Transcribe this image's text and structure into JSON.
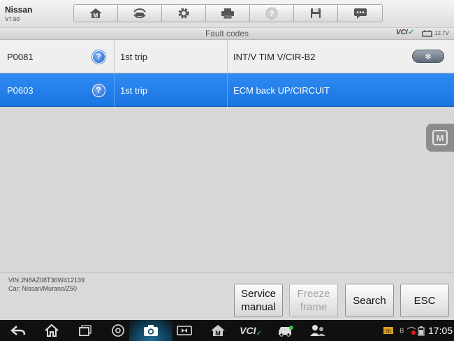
{
  "app": {
    "title": "Nissan",
    "version": "V7.50"
  },
  "toolbar": {
    "buttons": [
      "home-m-icon",
      "vehicle-swap-icon",
      "settings-gear-icon",
      "printer-icon",
      "help-icon",
      "save-icon",
      "message-icon"
    ]
  },
  "subheader": {
    "title": "Fault codes",
    "vci_label": "VCI",
    "battery_voltage": "12.7V"
  },
  "fault_codes": {
    "rows": [
      {
        "code": "P0081",
        "status": "1st trip",
        "description": "INT/V TIM V/CIR-B2",
        "selected": false,
        "has_freeze_frame": true
      },
      {
        "code": "P0603",
        "status": "1st trip",
        "description": "ECM back UP/CIRCUIT",
        "selected": true,
        "has_freeze_frame": false
      }
    ]
  },
  "side_tab": {
    "label": "M"
  },
  "footer": {
    "vin": "VIN:JN8AZ08T36W412139",
    "car": "Car: Nissan/Murano/Z50",
    "buttons": {
      "service_manual_line1": "Service",
      "service_manual_line2": "manual",
      "freeze_frame_line1": "Freeze",
      "freeze_frame_line2": "frame",
      "search": "Search",
      "esc": "ESC"
    }
  },
  "navbar": {
    "vci_label": "VCI",
    "clock": "17:05",
    "m_label": "M"
  },
  "colors": {
    "selected_row": "#1a74e2",
    "background": "#d7d7d7",
    "navbar": "#101010"
  }
}
